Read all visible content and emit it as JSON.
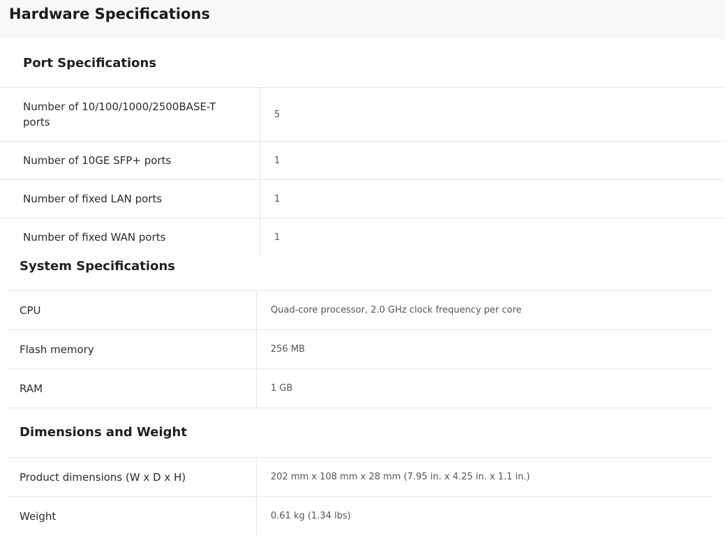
{
  "page": {
    "title": "Hardware Specifications"
  },
  "port_specs": {
    "title": "Port Specifications",
    "rows": [
      {
        "label": "Number of 10/100/1000/2500BASE-T ports",
        "value": "5"
      },
      {
        "label": "Number of 10GE SFP+ ports",
        "value": "1"
      },
      {
        "label": "Number of fixed LAN ports",
        "value": "1"
      },
      {
        "label": "Number of fixed WAN ports",
        "value": "1"
      }
    ]
  },
  "system_specs": {
    "title": "System Specifications",
    "rows": [
      {
        "label": "CPU",
        "value": "Quad-core processor, 2.0 GHz clock frequency per core"
      },
      {
        "label": "Flash memory",
        "value": "256 MB"
      },
      {
        "label": "RAM",
        "value": "1 GB"
      }
    ]
  },
  "dimensions": {
    "title": "Dimensions and Weight",
    "rows": [
      {
        "label": "Product dimensions (W x D x H)",
        "value": "202 mm x 108 mm x 28 mm (7.95 in. x 4.25 in. x 1.1 in.)"
      },
      {
        "label": "Weight",
        "value": "0.61 kg (1.34 lbs)"
      }
    ]
  },
  "colors": {
    "header_bg": "#f7f8fa",
    "border": "#e6e6e6",
    "label_text": "#2b2b2b",
    "value_text": "#555555"
  }
}
